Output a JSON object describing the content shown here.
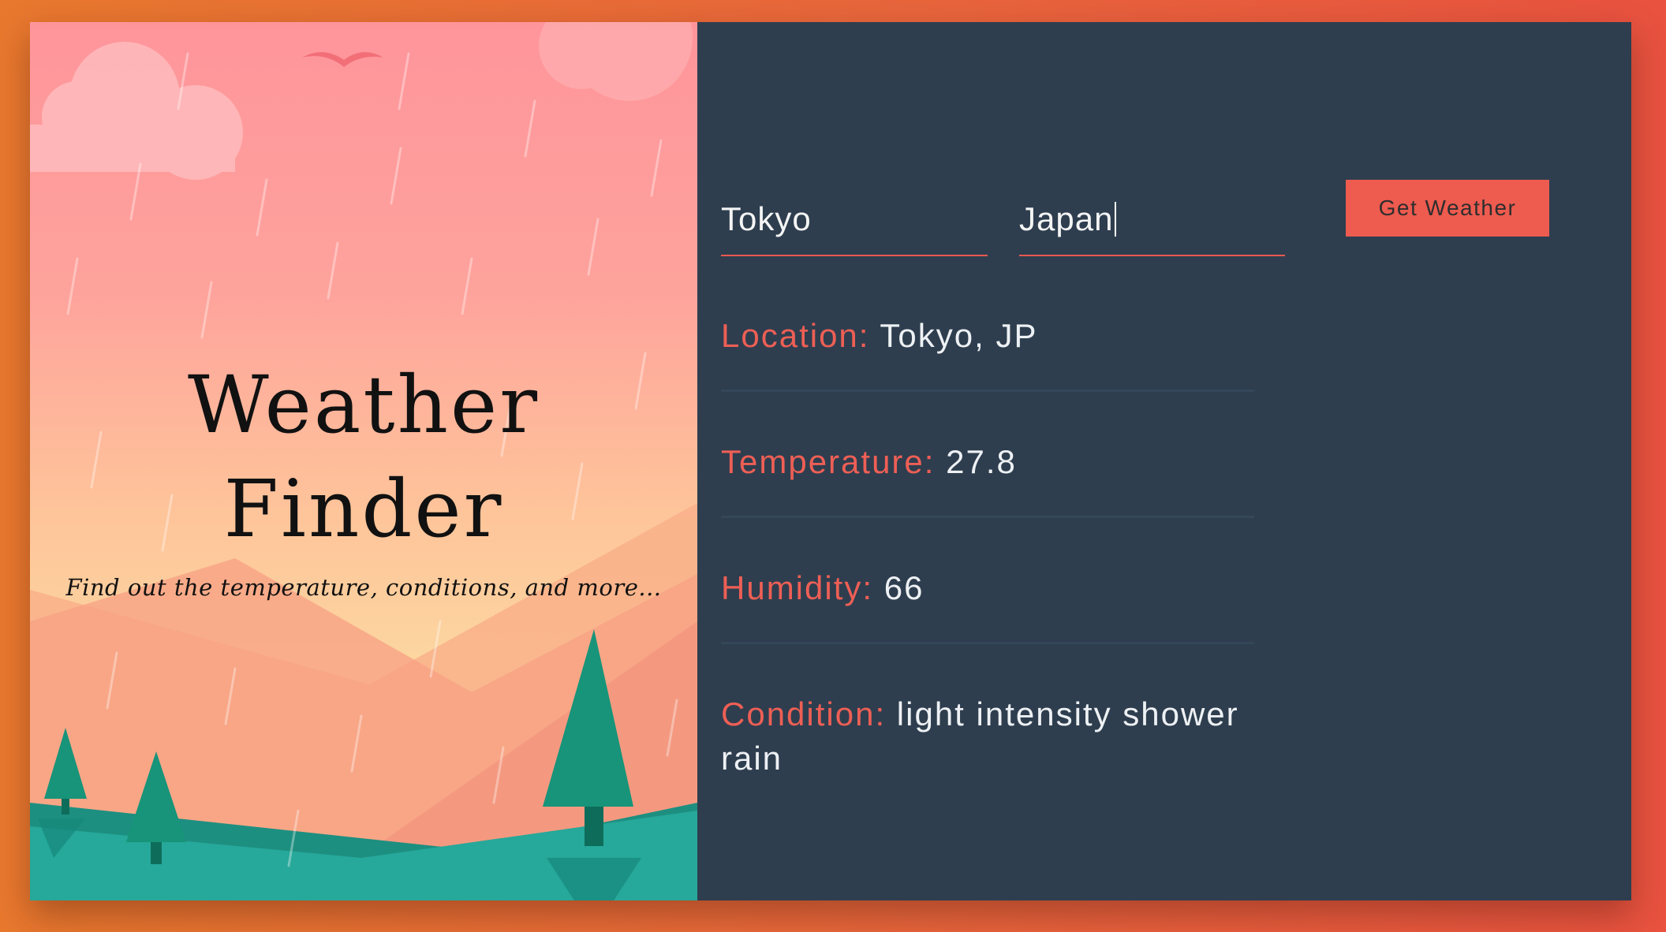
{
  "hero": {
    "title_line1": "Weather",
    "title_line2": "Finder",
    "subtitle": "Find out the temperature, conditions, and more..."
  },
  "form": {
    "city_value": "Tokyo",
    "country_value": "Japan",
    "submit_label": "Get Weather"
  },
  "results": {
    "location_label": "Location:",
    "location_value": "Tokyo, JP",
    "temperature_label": "Temperature:",
    "temperature_value": "27.8",
    "humidity_label": "Humidity:",
    "humidity_value": "66",
    "condition_label": "Condition:",
    "condition_value": "light intensity shower rain"
  },
  "colors": {
    "accent": "#ee5b4f",
    "panel": "#2e3e4f",
    "background_orange": "#e8782e"
  }
}
